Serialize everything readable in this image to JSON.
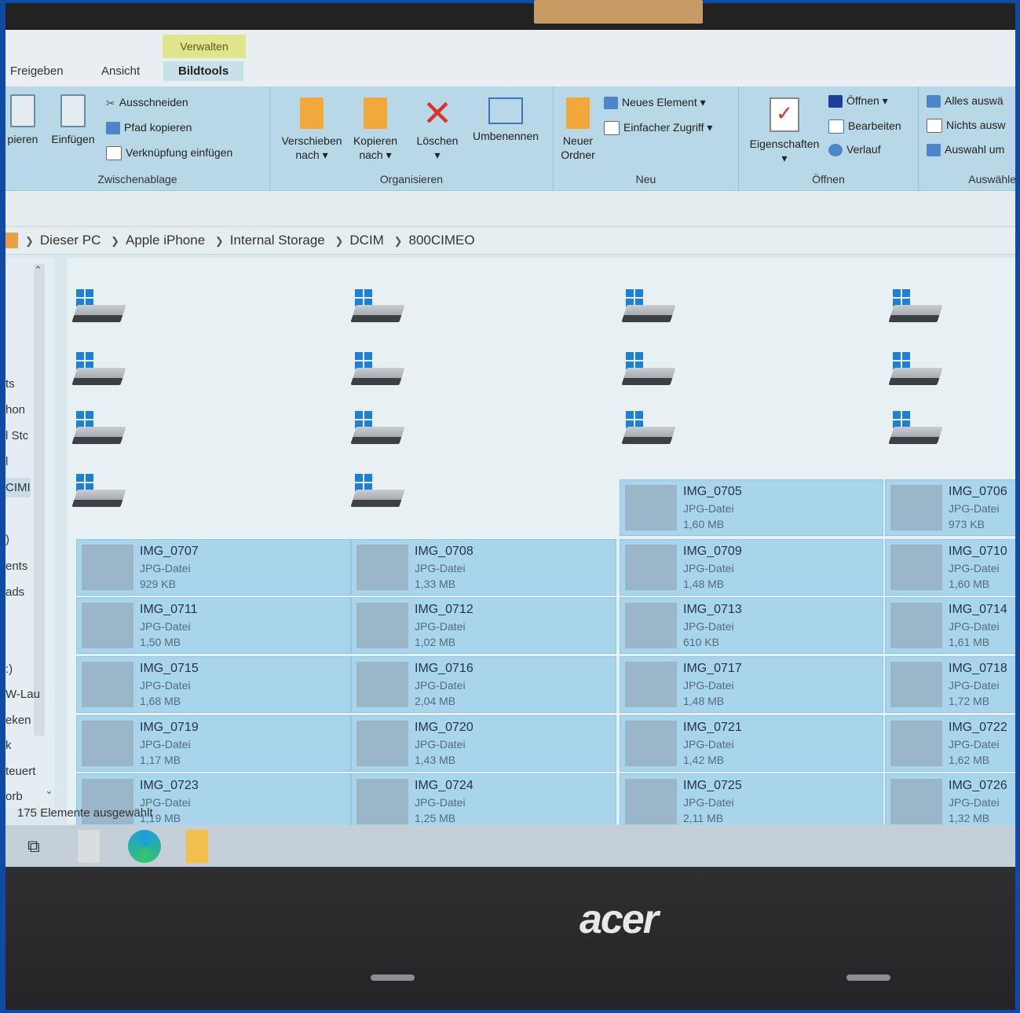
{
  "ribbon": {
    "context_group": "Verwalten",
    "tabs": [
      "Freigeben",
      "Ansicht",
      "Bildtools"
    ],
    "clipboard": {
      "copy_partial": "pieren",
      "paste": "Einfügen",
      "cut": "Ausschneiden",
      "copy_path": "Pfad kopieren",
      "paste_shortcut": "Verknüpfung einfügen",
      "label": "Zwischenablage"
    },
    "organize": {
      "move_line1": "Verschieben",
      "move_line2": "nach ▾",
      "copy_line1": "Kopieren",
      "copy_line2": "nach ▾",
      "delete": "Löschen",
      "delete_arrow": "▾",
      "rename": "Umbenennen",
      "label": "Organisieren"
    },
    "new": {
      "folder_line1": "Neuer",
      "folder_line2": "Ordner",
      "new_item": "Neues Element ▾",
      "easy_access": "Einfacher Zugriff ▾",
      "label": "Neu"
    },
    "open": {
      "properties": "Eigenschaften",
      "properties_arrow": "▾",
      "open": "Öffnen ▾",
      "edit": "Bearbeiten",
      "history": "Verlauf",
      "label": "Öffnen"
    },
    "select": {
      "all": "Alles auswä",
      "none": "Nichts ausw",
      "invert": "Auswahl um",
      "label": "Auswähle"
    }
  },
  "breadcrumb": [
    "Dieser PC",
    "Apple iPhone",
    "Internal Storage",
    "DCIM",
    "800CIMEO"
  ],
  "nav": [
    "ts",
    "hon",
    "l Stc",
    "l",
    "CIMI",
    ")",
    "ents",
    "ads",
    ":)",
    "W-Lau",
    "eken",
    "k",
    "teuert",
    "orb"
  ],
  "files": [
    {
      "name": "IMG_0705",
      "type": "JPG-Datei",
      "size": "1,60 MB"
    },
    {
      "name": "IMG_0706",
      "type": "JPG-Datei",
      "size": "973 KB"
    },
    {
      "name": "IMG_0707",
      "type": "JPG-Datei",
      "size": "929 KB"
    },
    {
      "name": "IMG_0708",
      "type": "JPG-Datei",
      "size": "1,33 MB"
    },
    {
      "name": "IMG_0709",
      "type": "JPG-Datei",
      "size": "1,48 MB"
    },
    {
      "name": "IMG_0710",
      "type": "JPG-Datei",
      "size": "1,60 MB"
    },
    {
      "name": "IMG_0711",
      "type": "JPG-Datei",
      "size": "1,50 MB"
    },
    {
      "name": "IMG_0712",
      "type": "JPG-Datei",
      "size": "1,02 MB"
    },
    {
      "name": "IMG_0713",
      "type": "JPG-Datei",
      "size": "610 KB"
    },
    {
      "name": "IMG_0714",
      "type": "JPG-Datei",
      "size": "1,61 MB"
    },
    {
      "name": "IMG_0715",
      "type": "JPG-Datei",
      "size": "1,68 MB"
    },
    {
      "name": "IMG_0716",
      "type": "JPG-Datei",
      "size": "2,04 MB"
    },
    {
      "name": "IMG_0717",
      "type": "JPG-Datei",
      "size": "1,48 MB"
    },
    {
      "name": "IMG_0718",
      "type": "JPG-Datei",
      "size": "1,72 MB"
    },
    {
      "name": "IMG_0719",
      "type": "JPG-Datei",
      "size": "1,17 MB"
    },
    {
      "name": "IMG_0720",
      "type": "JPG-Datei",
      "size": "1,43 MB"
    },
    {
      "name": "IMG_0721",
      "type": "JPG-Datei",
      "size": "1,42 MB"
    },
    {
      "name": "IMG_0722",
      "type": "JPG-Datei",
      "size": "1,62 MB"
    },
    {
      "name": "IMG_0723",
      "type": "JPG-Datei",
      "size": "1,19 MB"
    },
    {
      "name": "IMG_0724",
      "type": "JPG-Datei",
      "size": "1,25 MB"
    },
    {
      "name": "IMG_0725",
      "type": "JPG-Datei",
      "size": "2,11 MB"
    },
    {
      "name": "IMG_0726",
      "type": "JPG-Datei",
      "size": "1,32 MB"
    }
  ],
  "status": "175 Elemente ausgewählt",
  "taskbar": {
    "task_view_icon": "task-view-icon",
    "apps": [
      "file-icon",
      "edge-icon",
      "explorer-icon"
    ]
  },
  "laptop_logo": "acer",
  "colors": {
    "selection": "#a9d5ec",
    "ribbon": "#b8d8e8",
    "context_group": "#dfe58a",
    "delete": "#d8342a"
  }
}
